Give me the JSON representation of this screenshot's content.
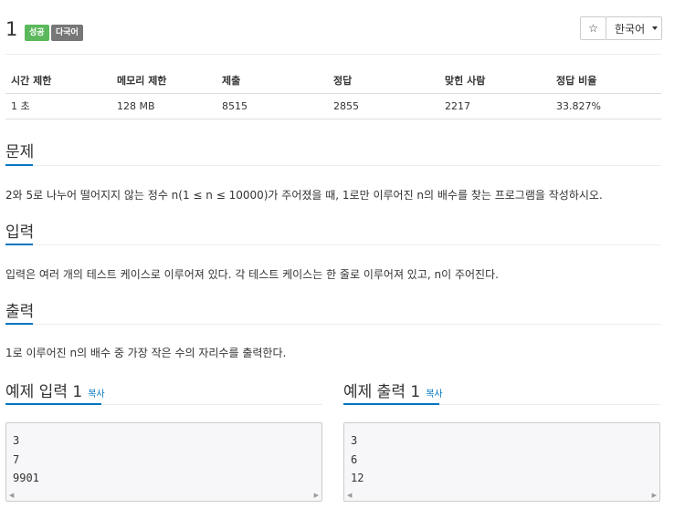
{
  "problem": {
    "title": "1",
    "badge_success": "성공",
    "badge_lang": "다국어",
    "star_icon": "☆",
    "language_select": "한국어"
  },
  "info_table": {
    "headers": [
      "시간 제한",
      "메모리 제한",
      "제출",
      "정답",
      "맞힌 사람",
      "정답 비율"
    ],
    "values": [
      "1 초",
      "128 MB",
      "8515",
      "2855",
      "2217",
      "33.827%"
    ]
  },
  "sections": {
    "problem_title": "문제",
    "problem_text": "2와 5로 나누어 떨어지지 않는 정수 n(1 ≤ n ≤ 10000)가 주어졌을 때, 1로만 이루어진 n의 배수를 찾는 프로그램을 작성하시오.",
    "input_title": "입력",
    "input_text": "입력은 여러 개의 테스트 케이스로 이루어져 있다. 각 테스트 케이스는 한 줄로 이루어져 있고, n이 주어진다.",
    "output_title": "출력",
    "output_text": "1로 이루어진 n의 배수 중 가장 작은 수의 자리수를 출력한다."
  },
  "samples": {
    "input_title": "예제 입력 1",
    "output_title": "예제 출력 1",
    "copy_label": "복사",
    "input_lines": [
      "3",
      "7",
      "9901"
    ],
    "output_lines": [
      "3",
      "6",
      "12"
    ]
  }
}
